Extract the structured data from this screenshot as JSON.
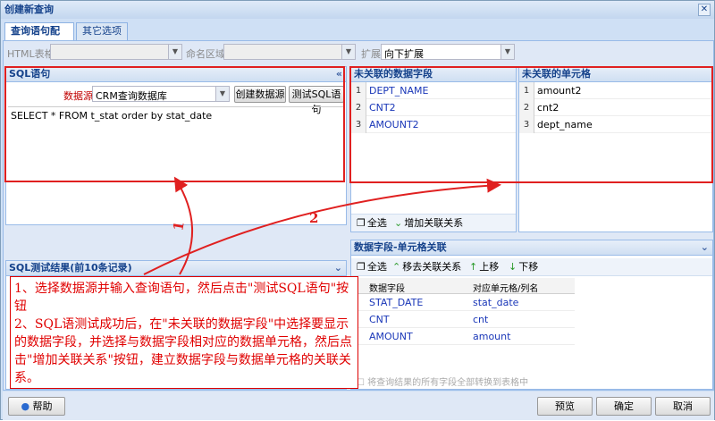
{
  "window": {
    "title": "创建新查询",
    "close_symbol": "✕"
  },
  "tabs": [
    "查询语句配置",
    "其它选项"
  ],
  "top_fields": {
    "html_label": "HTML表格",
    "name_label": "命名区域",
    "expand_label": "扩展",
    "expand_value": "向下扩展"
  },
  "sql_panel": {
    "title": "SQL语句",
    "collapse_symbol": "«",
    "datasource_label": "数据源",
    "datasource_value": "CRM查询数据库",
    "create_ds_btn": "创建数据源",
    "test_sql_btn": "测试SQL语句",
    "sql_text": "SELECT * FROM t_stat order by stat_date"
  },
  "fields_panel": {
    "title": "未关联的数据字段",
    "rows": [
      {
        "n": "1",
        "v": "DEPT_NAME"
      },
      {
        "n": "2",
        "v": "CNT2"
      },
      {
        "n": "3",
        "v": "AMOUNT2"
      }
    ],
    "select_all": "全选",
    "add_relation": "增加关联关系"
  },
  "cells_panel": {
    "title": "未关联的单元格",
    "rows": [
      {
        "n": "1",
        "v": "amount2"
      },
      {
        "n": "2",
        "v": "cnt2"
      },
      {
        "n": "3",
        "v": "dept_name"
      }
    ]
  },
  "relations_panel": {
    "title": "数据字段-单元格关联",
    "collapse_symbol": "⌄",
    "select_all": "全选",
    "remove_relation": "移去关联关系",
    "move_up": "上移",
    "move_down": "下移",
    "col_field": "数据字段",
    "col_cell": "对应单元格/列名",
    "rows": [
      {
        "f": "STAT_DATE",
        "c": "stat_date"
      },
      {
        "f": "CNT",
        "c": "cnt"
      },
      {
        "f": "AMOUNT",
        "c": "amount"
      }
    ],
    "convert_text": "将查询结果的所有字段全部转换到表格中"
  },
  "result_panel": {
    "title": "SQL测试结果(前10条记录)",
    "collapse_symbol": "⌄"
  },
  "annotation": {
    "marker1": "1",
    "marker2": "2",
    "text": "1、选择数据源并输入查询语句，然后点击\"测试SQL语句\"按钮\n2、SQL语测试成功后，在\"未关联的数据字段\"中选择要显示的数据字段，并选择与数据字段相对应的数据单元格，然后点击\"增加关联关系\"按钮，建立数据字段与数据单元格的关联关系。"
  },
  "footer": {
    "help": "帮助",
    "preview": "预览",
    "ok": "确定",
    "cancel": "取消"
  },
  "colors": {
    "annotation_red": "#e02020",
    "link_blue": "#1a37b8",
    "header_blue": "#15428b"
  }
}
